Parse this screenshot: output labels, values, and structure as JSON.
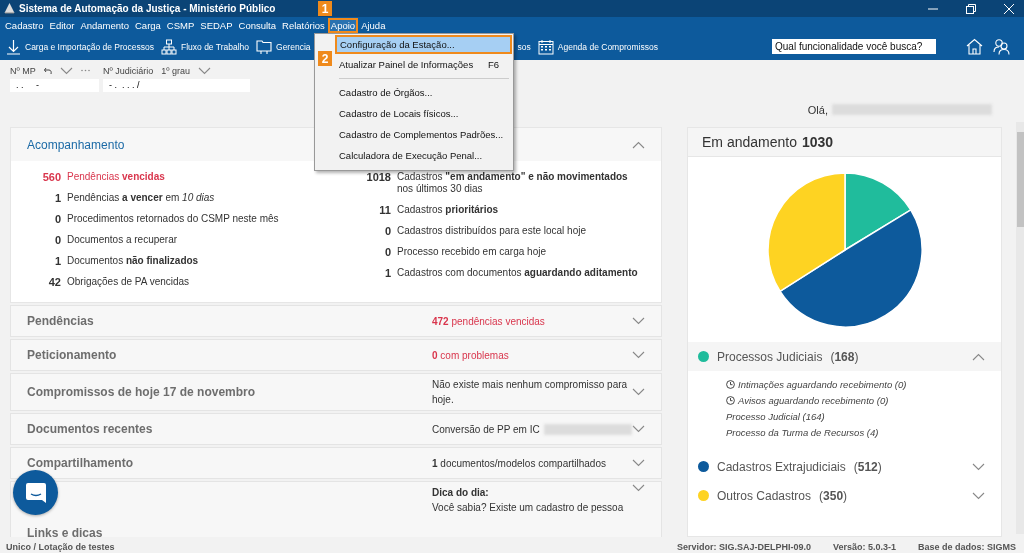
{
  "window": {
    "title": "Sistema de Automação da Justiça - Ministério Público"
  },
  "menu_bar": [
    {
      "label": "Cadastro",
      "selected": false
    },
    {
      "label": "Editor",
      "selected": false
    },
    {
      "label": "Andamento",
      "selected": false
    },
    {
      "label": "Carga",
      "selected": false
    },
    {
      "label": "CSMP",
      "selected": false
    },
    {
      "label": "SEDAP",
      "selected": false
    },
    {
      "label": "Consulta",
      "selected": false
    },
    {
      "label": "Relatórios",
      "selected": false
    },
    {
      "label": "Apoio",
      "selected": true
    },
    {
      "label": "Ajuda",
      "selected": false
    }
  ],
  "callouts": [
    "1",
    "2"
  ],
  "open_menu": [
    {
      "kind": "item",
      "label": "Configuração da Estação...",
      "selected": true
    },
    {
      "kind": "item",
      "label": "Atualizar Painel de Informações",
      "shortcut": "F6",
      "selected": false
    },
    {
      "kind": "separator"
    },
    {
      "kind": "item",
      "label": "Cadastro de Órgãos...",
      "selected": false
    },
    {
      "kind": "item",
      "label": "Cadastro de Locais físicos...",
      "selected": false
    },
    {
      "kind": "item",
      "label": "Cadastro de Complementos Padrões...",
      "selected": false
    },
    {
      "kind": "item",
      "label": "Calculadora de Execução Penal...",
      "selected": false
    }
  ],
  "toolbar": [
    "Carga e Importação de Processos",
    "Fluxo de Trabalho",
    "Gerencia",
    "sos",
    "Agenda de Compromissos"
  ],
  "search": {
    "placeholder": "Qual funcionalidade você busca?"
  },
  "filters": [
    {
      "label": "Nº MP",
      "value": ". .     -"
    },
    {
      "label": "Nº Judiciário",
      "option": "1º grau",
      "value": "- .  . . . /"
    }
  ],
  "greeting": "Olá,",
  "tracking": {
    "title": "Acompanhamento",
    "expanded": true,
    "left": [
      {
        "count": "560",
        "text": "Pendências **vencidas**",
        "alert": true
      },
      {
        "count": "1",
        "text": "Pendências **a vencer** em *10 dias*",
        "alert": false
      },
      {
        "count": "0",
        "text": "Procedimentos retornados do CSMP neste mês",
        "alert": false
      },
      {
        "count": "0",
        "text": "Documentos a recuperar",
        "alert": false
      },
      {
        "count": "1",
        "text": "Documentos **não finalizados**",
        "alert": false
      },
      {
        "count": "42",
        "text": "Obrigações de PA vencidas",
        "alert": false
      }
    ],
    "right": [
      {
        "count": "1018",
        "text": "Cadastros **\"em andamento\" e não movimentados** nos últimos 30 dias",
        "alert": false
      },
      {
        "count": "11",
        "text": "Cadastros **prioritários**",
        "alert": false
      },
      {
        "count": "0",
        "text": "Cadastros distribuídos para este local hoje",
        "alert": false
      },
      {
        "count": "0",
        "text": "Processo recebido em carga hoje",
        "alert": false
      },
      {
        "count": "1",
        "text": "Cadastros com documentos **aguardando aditamento**",
        "alert": false
      }
    ]
  },
  "sections": [
    {
      "title": "Pendências",
      "summary": [
        "**472** pendências vencidas"
      ],
      "alert": true,
      "expanded": false
    },
    {
      "title": "Peticionamento",
      "summary": [
        "**0** com problemas"
      ],
      "alert": true,
      "expanded": false
    },
    {
      "title": "Compromissos de hoje 17 de novembro",
      "summary": [
        "Não existe mais nenhum compromisso para hoje."
      ],
      "alert": false,
      "expanded": false
    },
    {
      "title": "Documentos recentes",
      "summary": [
        "Conversão de PP em IC"
      ],
      "redacted": true,
      "alert": false,
      "expanded": false
    },
    {
      "title": "Compartilhamento",
      "summary": [
        "**1** documentos/modelos compartilhados"
      ],
      "alert": false,
      "expanded": false
    },
    {
      "title": "Links e dicas",
      "summary": [
        "**Dica do dia:**",
        "Você sabia? Existe um cadastro de pessoa"
      ],
      "alert": false,
      "expanded": false
    }
  ],
  "in_progress": {
    "title": "Em andamento",
    "count": "1030",
    "chart_data": {
      "type": "pie",
      "categories": [
        "Processos Judiciais",
        "Cadastros Extrajudiciais",
        "Outros Cadastros"
      ],
      "values": [
        16.3,
        49.7,
        34.0
      ]
    },
    "groups": [
      {
        "count": "(**168**)",
        "color": "#20bc9c",
        "expanded": true,
        "children": [
          {
            "kind": "clock",
            "text": "Intimações aguardando recebimento (0)"
          },
          {
            "kind": "clock",
            "text": "Avisos aguardando recebimento (0)"
          },
          {
            "kind": "plain",
            "text": "Processo Judicial (164)"
          },
          {
            "kind": "plain",
            "text": "Processo da Turma de Recursos (4)"
          }
        ]
      },
      {
        "count": "(**512**)",
        "color": "#0d5a9c",
        "expanded": false
      },
      {
        "count": "(**350**)",
        "color": "#fed322",
        "expanded": false
      }
    ]
  },
  "status_bar": {
    "left": "Unico / Lotação de testes",
    "right": [
      "Servidor: SIG.SAJ-DELPHI-09.0",
      "Versão: 5.0.3-1",
      "Base de dados: SIGMS"
    ]
  }
}
